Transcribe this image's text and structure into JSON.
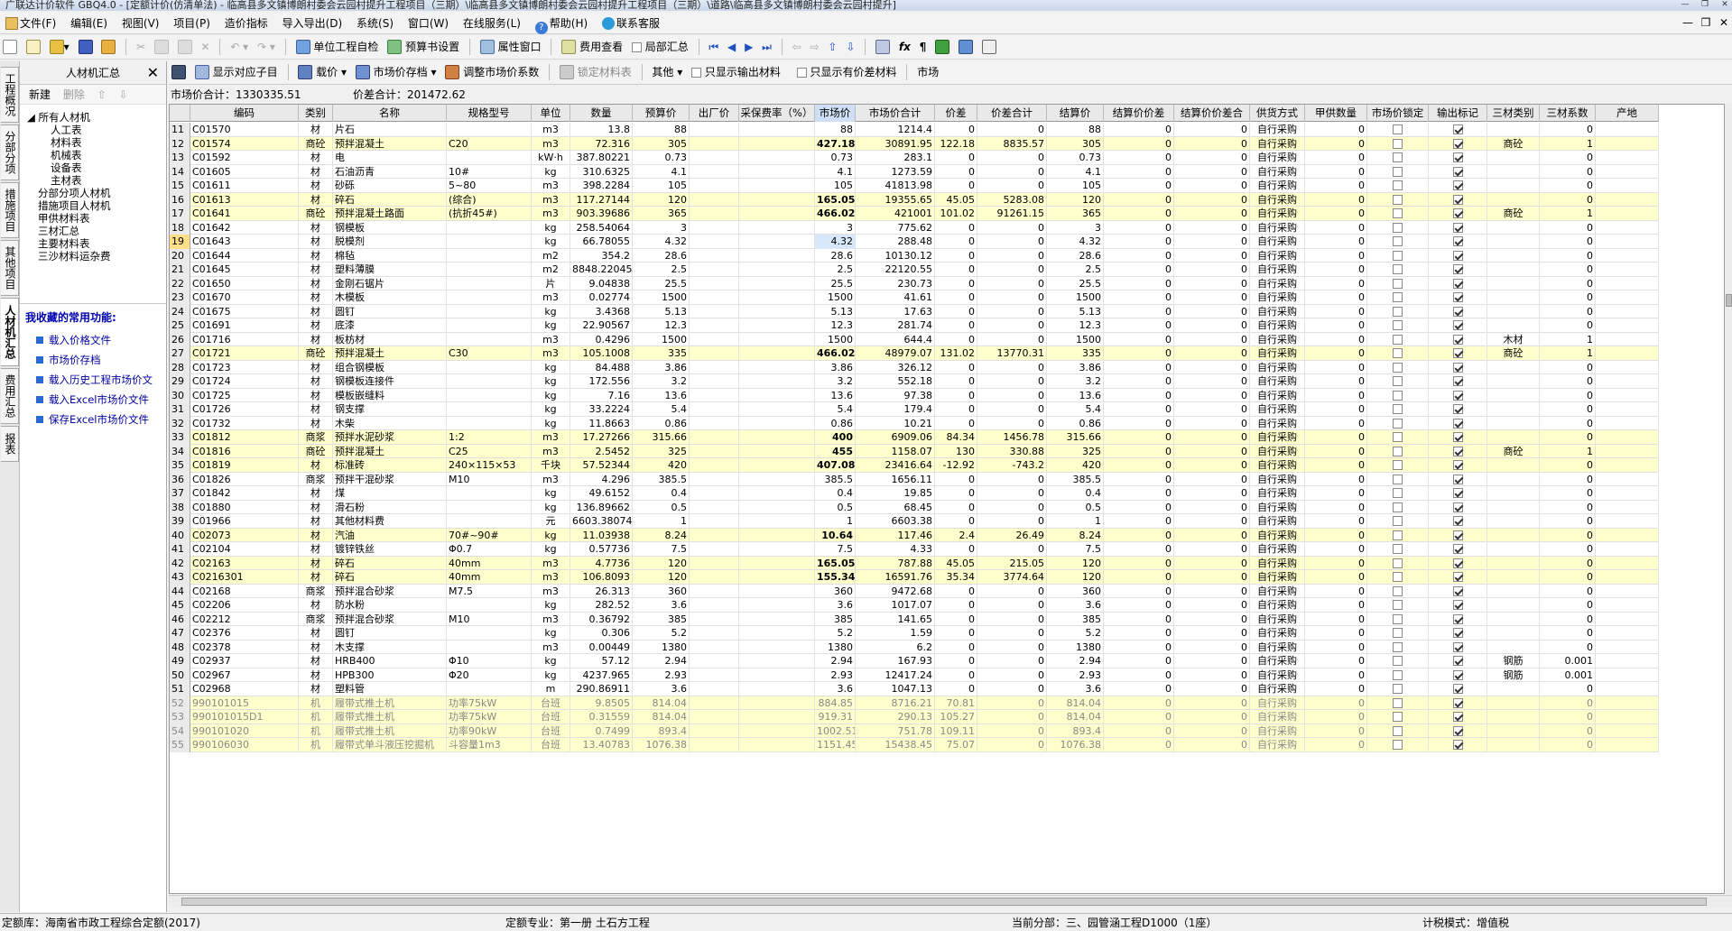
{
  "title": "广联达计价软件 GBQ4.0 - [定额计价(仿清单法) - 临高县多文镇博朗村委会云园村提升工程项目（三期）\\临高县多文镇博朗村委会云园村提升工程项目（三期）\\道路\\临高县多文镇博朗村委会云园村提升]",
  "menu": [
    "文件(F)",
    "编辑(E)",
    "视图(V)",
    "项目(P)",
    "造价指标",
    "导入导出(D)",
    "系统(S)",
    "窗口(W)",
    "在线服务(L)",
    "帮助(H)",
    "联系客服"
  ],
  "toolbar1": {
    "check": "单位工程自检",
    "preview": "预算书设置",
    "prop": "属性窗口",
    "fee": "费用查看",
    "partial": "局部汇总"
  },
  "left_tabs": [
    "工程概况",
    "分部分项",
    "措施项目",
    "其他项目",
    "人材机汇总",
    "费用汇总",
    "报表"
  ],
  "panel": {
    "title": "人材机汇总",
    "new": "新建",
    "delete": "删除",
    "tree": [
      "所有人材机",
      "人工表",
      "材料表",
      "机械表",
      "设备表",
      "主材表",
      "分部分项人材机",
      "措施项目人材机",
      "甲供材料表",
      "三材汇总",
      "主要材料表",
      "三沙材料运杂费"
    ],
    "fav_title": "我收藏的常用功能:",
    "fav": [
      "载入价格文件",
      "市场价存档",
      "载入历史工程市场价文",
      "载入Excel市场价文件",
      "保存Excel市场价文件"
    ]
  },
  "toolbar2": {
    "show_child": "显示对应子目",
    "price": "载价",
    "archive": "市场价存档",
    "adjust": "调整市场价系数",
    "lock": "锁定材料表",
    "other": "其他",
    "only_out": "只显示输出材料",
    "only_diff": "只显示有价差材料",
    "market": "市场"
  },
  "summary": {
    "market_total": "市场价合计：1330335.51",
    "diff_total": "价差合计：201472.62"
  },
  "columns": [
    "",
    "编码",
    "类别",
    "名称",
    "规格型号",
    "单位",
    "数量",
    "预算价",
    "出厂价",
    "采保费率（%）",
    "市场价",
    "市场价合计",
    "价差",
    "价差合计",
    "结算价",
    "结算价价差",
    "结算价价差合",
    "供货方式",
    "甲供数量",
    "市场价锁定",
    "输出标记",
    "三材类别",
    "三材系数",
    "产地"
  ],
  "rows": [
    [
      "11",
      "C01570",
      "材",
      "片石",
      "",
      "m3",
      "13.8",
      "88",
      "",
      "",
      "88",
      "1214.4",
      "0",
      "0",
      "88",
      "0",
      "0",
      "自行采购",
      "0",
      "0",
      "1",
      "",
      "0",
      ""
    ],
    [
      "12",
      "C01574",
      "商砼",
      "预拌混凝土",
      "C20",
      "m3",
      "72.316",
      "305",
      "",
      "",
      "427.18",
      "30891.95",
      "122.18",
      "8835.57",
      "305",
      "0",
      "0",
      "自行采购",
      "0",
      "0",
      "1",
      "商砼",
      "1",
      ""
    ],
    [
      "13",
      "C01592",
      "材",
      "电",
      "",
      "kW·h",
      "387.80221",
      "0.73",
      "",
      "",
      "0.73",
      "283.1",
      "0",
      "0",
      "0.73",
      "0",
      "0",
      "自行采购",
      "0",
      "0",
      "1",
      "",
      "0",
      ""
    ],
    [
      "14",
      "C01605",
      "材",
      "石油沥青",
      "10#",
      "kg",
      "310.6325",
      "4.1",
      "",
      "",
      "4.1",
      "1273.59",
      "0",
      "0",
      "4.1",
      "0",
      "0",
      "自行采购",
      "0",
      "0",
      "1",
      "",
      "0",
      ""
    ],
    [
      "15",
      "C01611",
      "材",
      "砂砾",
      "5~80",
      "m3",
      "398.2284",
      "105",
      "",
      "",
      "105",
      "41813.98",
      "0",
      "0",
      "105",
      "0",
      "0",
      "自行采购",
      "0",
      "0",
      "1",
      "",
      "0",
      ""
    ],
    [
      "16",
      "C01613",
      "材",
      "碎石",
      "(综合)",
      "m3",
      "117.27144",
      "120",
      "",
      "",
      "165.05",
      "19355.65",
      "45.05",
      "5283.08",
      "120",
      "0",
      "0",
      "自行采购",
      "0",
      "0",
      "1",
      "",
      "0",
      ""
    ],
    [
      "17",
      "C01641",
      "商砼",
      "预拌混凝土路面",
      "(抗折45#)",
      "m3",
      "903.39686",
      "365",
      "",
      "",
      "466.02",
      "421001",
      "101.02",
      "91261.15",
      "365",
      "0",
      "0",
      "自行采购",
      "0",
      "0",
      "1",
      "商砼",
      "1",
      ""
    ],
    [
      "18",
      "C01642",
      "材",
      "钢模板",
      "",
      "kg",
      "258.54064",
      "3",
      "",
      "",
      "3",
      "775.62",
      "0",
      "0",
      "3",
      "0",
      "0",
      "自行采购",
      "0",
      "0",
      "1",
      "",
      "0",
      ""
    ],
    [
      "19",
      "C01643",
      "材",
      "脱模剂",
      "",
      "kg",
      "66.78055",
      "4.32",
      "",
      "",
      "4.32",
      "288.48",
      "0",
      "0",
      "4.32",
      "0",
      "0",
      "自行采购",
      "0",
      "0",
      "1",
      "",
      "0",
      ""
    ],
    [
      "20",
      "C01644",
      "材",
      "棉毡",
      "",
      "m2",
      "354.2",
      "28.6",
      "",
      "",
      "28.6",
      "10130.12",
      "0",
      "0",
      "28.6",
      "0",
      "0",
      "自行采购",
      "0",
      "0",
      "1",
      "",
      "0",
      ""
    ],
    [
      "21",
      "C01645",
      "材",
      "塑料薄膜",
      "",
      "m2",
      "8848.22045",
      "2.5",
      "",
      "",
      "2.5",
      "22120.55",
      "0",
      "0",
      "2.5",
      "0",
      "0",
      "自行采购",
      "0",
      "0",
      "1",
      "",
      "0",
      ""
    ],
    [
      "22",
      "C01650",
      "材",
      "金刚石锯片",
      "",
      "片",
      "9.04838",
      "25.5",
      "",
      "",
      "25.5",
      "230.73",
      "0",
      "0",
      "25.5",
      "0",
      "0",
      "自行采购",
      "0",
      "0",
      "1",
      "",
      "0",
      ""
    ],
    [
      "23",
      "C01670",
      "材",
      "木模板",
      "",
      "m3",
      "0.02774",
      "1500",
      "",
      "",
      "1500",
      "41.61",
      "0",
      "0",
      "1500",
      "0",
      "0",
      "自行采购",
      "0",
      "0",
      "1",
      "",
      "0",
      ""
    ],
    [
      "24",
      "C01675",
      "材",
      "圆钉",
      "",
      "kg",
      "3.4368",
      "5.13",
      "",
      "",
      "5.13",
      "17.63",
      "0",
      "0",
      "5.13",
      "0",
      "0",
      "自行采购",
      "0",
      "0",
      "1",
      "",
      "0",
      ""
    ],
    [
      "25",
      "C01691",
      "材",
      "底漆",
      "",
      "kg",
      "22.90567",
      "12.3",
      "",
      "",
      "12.3",
      "281.74",
      "0",
      "0",
      "12.3",
      "0",
      "0",
      "自行采购",
      "0",
      "0",
      "1",
      "",
      "0",
      ""
    ],
    [
      "26",
      "C01716",
      "材",
      "板枋材",
      "",
      "m3",
      "0.4296",
      "1500",
      "",
      "",
      "1500",
      "644.4",
      "0",
      "0",
      "1500",
      "0",
      "0",
      "自行采购",
      "0",
      "0",
      "1",
      "木材",
      "1",
      ""
    ],
    [
      "27",
      "C01721",
      "商砼",
      "预拌混凝土",
      "C30",
      "m3",
      "105.1008",
      "335",
      "",
      "",
      "466.02",
      "48979.07",
      "131.02",
      "13770.31",
      "335",
      "0",
      "0",
      "自行采购",
      "0",
      "0",
      "1",
      "商砼",
      "1",
      ""
    ],
    [
      "28",
      "C01723",
      "材",
      "组合钢模板",
      "",
      "kg",
      "84.488",
      "3.86",
      "",
      "",
      "3.86",
      "326.12",
      "0",
      "0",
      "3.86",
      "0",
      "0",
      "自行采购",
      "0",
      "0",
      "1",
      "",
      "0",
      ""
    ],
    [
      "29",
      "C01724",
      "材",
      "钢模板连接件",
      "",
      "kg",
      "172.556",
      "3.2",
      "",
      "",
      "3.2",
      "552.18",
      "0",
      "0",
      "3.2",
      "0",
      "0",
      "自行采购",
      "0",
      "0",
      "1",
      "",
      "0",
      ""
    ],
    [
      "30",
      "C01725",
      "材",
      "模板嵌缝料",
      "",
      "kg",
      "7.16",
      "13.6",
      "",
      "",
      "13.6",
      "97.38",
      "0",
      "0",
      "13.6",
      "0",
      "0",
      "自行采购",
      "0",
      "0",
      "1",
      "",
      "0",
      ""
    ],
    [
      "31",
      "C01726",
      "材",
      "钢支撑",
      "",
      "kg",
      "33.2224",
      "5.4",
      "",
      "",
      "5.4",
      "179.4",
      "0",
      "0",
      "5.4",
      "0",
      "0",
      "自行采购",
      "0",
      "0",
      "1",
      "",
      "0",
      ""
    ],
    [
      "32",
      "C01732",
      "材",
      "木柴",
      "",
      "kg",
      "11.8663",
      "0.86",
      "",
      "",
      "0.86",
      "10.21",
      "0",
      "0",
      "0.86",
      "0",
      "0",
      "自行采购",
      "0",
      "0",
      "1",
      "",
      "0",
      ""
    ],
    [
      "33",
      "C01812",
      "商浆",
      "预拌水泥砂浆",
      "1:2",
      "m3",
      "17.27266",
      "315.66",
      "",
      "",
      "400",
      "6909.06",
      "84.34",
      "1456.78",
      "315.66",
      "0",
      "0",
      "自行采购",
      "0",
      "0",
      "1",
      "",
      "0",
      ""
    ],
    [
      "34",
      "C01816",
      "商砼",
      "预拌混凝土",
      "C25",
      "m3",
      "2.5452",
      "325",
      "",
      "",
      "455",
      "1158.07",
      "130",
      "330.88",
      "325",
      "0",
      "0",
      "自行采购",
      "0",
      "0",
      "1",
      "商砼",
      "1",
      ""
    ],
    [
      "35",
      "C01819",
      "材",
      "标准砖",
      "240×115×53",
      "千块",
      "57.52344",
      "420",
      "",
      "",
      "407.08",
      "23416.64",
      "-12.92",
      "-743.2",
      "420",
      "0",
      "0",
      "自行采购",
      "0",
      "0",
      "1",
      "",
      "0",
      ""
    ],
    [
      "36",
      "C01826",
      "商浆",
      "预拌干混砂浆",
      "M10",
      "m3",
      "4.296",
      "385.5",
      "",
      "",
      "385.5",
      "1656.11",
      "0",
      "0",
      "385.5",
      "0",
      "0",
      "自行采购",
      "0",
      "0",
      "1",
      "",
      "0",
      ""
    ],
    [
      "37",
      "C01842",
      "材",
      "煤",
      "",
      "kg",
      "49.6152",
      "0.4",
      "",
      "",
      "0.4",
      "19.85",
      "0",
      "0",
      "0.4",
      "0",
      "0",
      "自行采购",
      "0",
      "0",
      "1",
      "",
      "0",
      ""
    ],
    [
      "38",
      "C01880",
      "材",
      "滑石粉",
      "",
      "kg",
      "136.89662",
      "0.5",
      "",
      "",
      "0.5",
      "68.45",
      "0",
      "0",
      "0.5",
      "0",
      "0",
      "自行采购",
      "0",
      "0",
      "1",
      "",
      "0",
      ""
    ],
    [
      "39",
      "C01966",
      "材",
      "其他材料费",
      "",
      "元",
      "6603.38074",
      "1",
      "",
      "",
      "1",
      "6603.38",
      "0",
      "0",
      "1",
      "0",
      "0",
      "自行采购",
      "0",
      "0",
      "1",
      "",
      "0",
      ""
    ],
    [
      "40",
      "C02073",
      "材",
      "汽油",
      "70#~90#",
      "kg",
      "11.03938",
      "8.24",
      "",
      "",
      "10.64",
      "117.46",
      "2.4",
      "26.49",
      "8.24",
      "0",
      "0",
      "自行采购",
      "0",
      "0",
      "1",
      "",
      "0",
      ""
    ],
    [
      "41",
      "C02104",
      "材",
      "镀锌铁丝",
      "Φ0.7",
      "kg",
      "0.57736",
      "7.5",
      "",
      "",
      "7.5",
      "4.33",
      "0",
      "0",
      "7.5",
      "0",
      "0",
      "自行采购",
      "0",
      "0",
      "1",
      "",
      "0",
      ""
    ],
    [
      "42",
      "C02163",
      "材",
      "碎石",
      "40mm",
      "m3",
      "4.7736",
      "120",
      "",
      "",
      "165.05",
      "787.88",
      "45.05",
      "215.05",
      "120",
      "0",
      "0",
      "自行采购",
      "0",
      "0",
      "1",
      "",
      "0",
      ""
    ],
    [
      "43",
      "C0216301",
      "材",
      "碎石",
      "40mm",
      "m3",
      "106.8093",
      "120",
      "",
      "",
      "155.34",
      "16591.76",
      "35.34",
      "3774.64",
      "120",
      "0",
      "0",
      "自行采购",
      "0",
      "0",
      "1",
      "",
      "0",
      ""
    ],
    [
      "44",
      "C02168",
      "商浆",
      "预拌混合砂浆",
      "M7.5",
      "m3",
      "26.313",
      "360",
      "",
      "",
      "360",
      "9472.68",
      "0",
      "0",
      "360",
      "0",
      "0",
      "自行采购",
      "0",
      "0",
      "1",
      "",
      "0",
      ""
    ],
    [
      "45",
      "C02206",
      "材",
      "防水粉",
      "",
      "kg",
      "282.52",
      "3.6",
      "",
      "",
      "3.6",
      "1017.07",
      "0",
      "0",
      "3.6",
      "0",
      "0",
      "自行采购",
      "0",
      "0",
      "1",
      "",
      "0",
      ""
    ],
    [
      "46",
      "C02212",
      "商浆",
      "预拌混合砂浆",
      "M10",
      "m3",
      "0.36792",
      "385",
      "",
      "",
      "385",
      "141.65",
      "0",
      "0",
      "385",
      "0",
      "0",
      "自行采购",
      "0",
      "0",
      "1",
      "",
      "0",
      ""
    ],
    [
      "47",
      "C02376",
      "材",
      "圆钉",
      "",
      "kg",
      "0.306",
      "5.2",
      "",
      "",
      "5.2",
      "1.59",
      "0",
      "0",
      "5.2",
      "0",
      "0",
      "自行采购",
      "0",
      "0",
      "1",
      "",
      "0",
      ""
    ],
    [
      "48",
      "C02378",
      "材",
      "木支撑",
      "",
      "m3",
      "0.00449",
      "1380",
      "",
      "",
      "1380",
      "6.2",
      "0",
      "0",
      "1380",
      "0",
      "0",
      "自行采购",
      "0",
      "0",
      "1",
      "",
      "0",
      ""
    ],
    [
      "49",
      "C02937",
      "材",
      "HRB400",
      "Φ10",
      "kg",
      "57.12",
      "2.94",
      "",
      "",
      "2.94",
      "167.93",
      "0",
      "0",
      "2.94",
      "0",
      "0",
      "自行采购",
      "0",
      "0",
      "1",
      "钢筋",
      "0.001",
      ""
    ],
    [
      "50",
      "C02967",
      "材",
      "HPB300",
      "Φ20",
      "kg",
      "4237.965",
      "2.93",
      "",
      "",
      "2.93",
      "12417.24",
      "0",
      "0",
      "2.93",
      "0",
      "0",
      "自行采购",
      "0",
      "0",
      "1",
      "钢筋",
      "0.001",
      ""
    ],
    [
      "51",
      "C02968",
      "材",
      "塑料管",
      "",
      "m",
      "290.86911",
      "3.6",
      "",
      "",
      "3.6",
      "1047.13",
      "0",
      "0",
      "3.6",
      "0",
      "0",
      "自行采购",
      "0",
      "0",
      "1",
      "",
      "0",
      ""
    ],
    [
      "52",
      "990101015",
      "机",
      "履带式推土机",
      "功率75kW",
      "台班",
      "9.8505",
      "814.04",
      "",
      "",
      "884.85",
      "8716.21",
      "70.81",
      "0",
      "814.04",
      "0",
      "0",
      "自行采购",
      "0",
      "0",
      "1",
      "",
      "0",
      ""
    ],
    [
      "53",
      "990101015D1",
      "机",
      "履带式推土机",
      "功率75kW",
      "台班",
      "0.31559",
      "814.04",
      "",
      "",
      "919.31",
      "290.13",
      "105.27",
      "0",
      "814.04",
      "0",
      "0",
      "自行采购",
      "0",
      "0",
      "1",
      "",
      "0",
      ""
    ],
    [
      "54",
      "990101020",
      "机",
      "履带式推土机",
      "功率90kW",
      "台班",
      "0.7499",
      "893.4",
      "",
      "",
      "1002.51",
      "751.78",
      "109.11",
      "0",
      "893.4",
      "0",
      "0",
      "自行采购",
      "0",
      "0",
      "1",
      "",
      "0",
      ""
    ],
    [
      "55",
      "990106030",
      "机",
      "履带式单斗液压挖掘机",
      "斗容量1m3",
      "台班",
      "13.40783",
      "1076.38",
      "",
      "",
      "1151.45",
      "15438.45",
      "75.07",
      "0",
      "1076.38",
      "0",
      "0",
      "自行采购",
      "0",
      "0",
      "1",
      "",
      "0",
      ""
    ]
  ],
  "yellow_rows": [
    "12",
    "16",
    "17",
    "27",
    "33",
    "34",
    "35",
    "40",
    "42",
    "43",
    "52",
    "53",
    "54",
    "55"
  ],
  "bold_market_rows": [
    "12",
    "16",
    "17",
    "27",
    "33",
    "34",
    "35",
    "40",
    "42",
    "43"
  ],
  "status": {
    "quota": "定额库：海南省市政工程综合定额(2017)",
    "major": "定额专业：第一册 土石方工程",
    "current": "当前分部：三、园管涵工程D1000（1座）",
    "tax": "计税模式：增值税"
  }
}
